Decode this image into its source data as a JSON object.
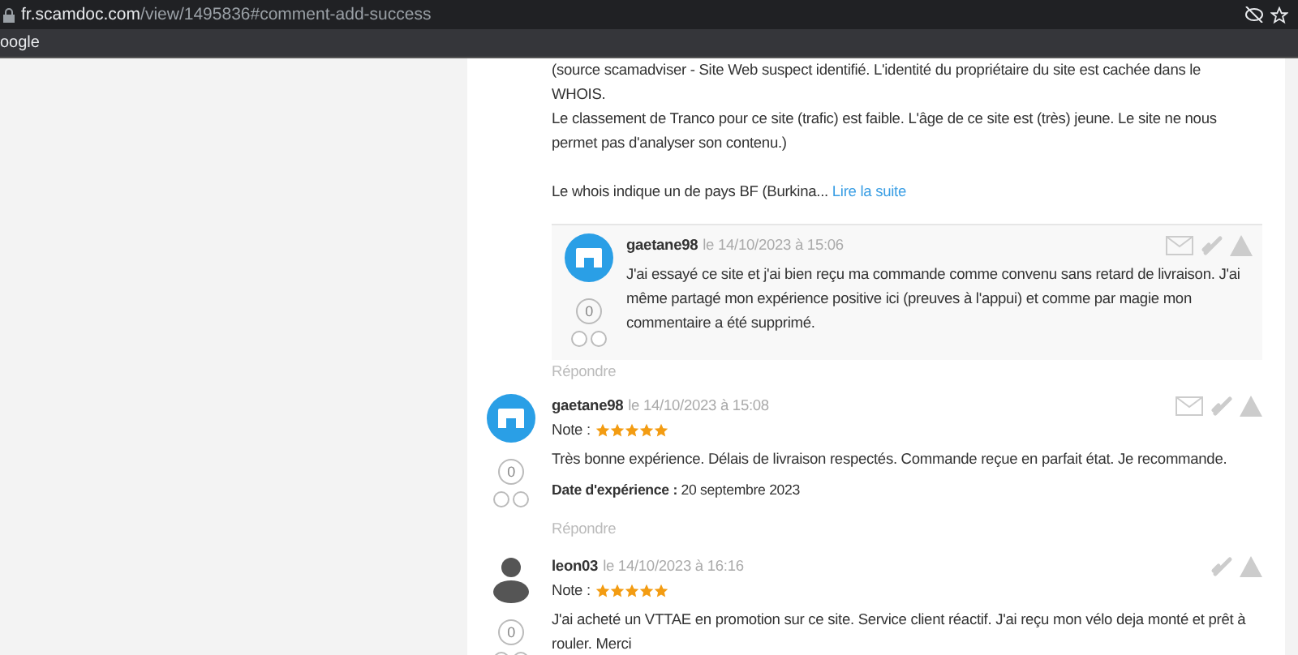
{
  "browser": {
    "host": "fr.scamdoc.com",
    "path": "/view/1495836#comment-add-success",
    "bookmark": "oogle"
  },
  "intro": {
    "lines": [
      "(source scamadviser - Site Web suspect identifié. L'identité du propriétaire du site est cachée dans le",
      "WHOIS.",
      "Le classement de Tranco pour ce site (trafic) est faible. L'âge de ce site est (très) jeune. Le site ne nous",
      "permet pas d'analyser son contenu.)"
    ],
    "excerpt": "Le whois indique un de pays BF (Burkina...",
    "link": "Lire la suite"
  },
  "reply": {
    "author": "gaetane98",
    "date": "le 14/10/2023 à 15:06",
    "kind": "logo",
    "score": "0",
    "text": "J'ai essayé ce site et j'ai bien reçu ma commande comme convenu sans retard de livraison. J'ai même partagé mon expérience positive ici (preuves à l'appui) et comme par magie mon commentaire a été supprimé.",
    "mail": true,
    "answer": "Répondre"
  },
  "comments": [
    {
      "author": "gaetane98",
      "date": "le 14/10/2023 à 15:08",
      "kind": "logo",
      "score": "0",
      "note_label": "Note :",
      "stars": 5,
      "text": "Très bonne expérience. Délais de livraison respectés. Commande reçue en parfait état. Je recommande.",
      "experience_label": "Date d'expérience :",
      "experience_date": "20 septembre 2023",
      "mail": true,
      "answer": "Répondre"
    },
    {
      "author": "leon03",
      "date": "le 14/10/2023 à 16:16",
      "kind": "person",
      "score": "0",
      "note_label": "Note :",
      "stars": 5,
      "text": "J'ai acheté un VTTAE en promotion sur ce site. Service client réactif. J'ai reçu mon vélo deja monté et prêt à rouler. Merci",
      "mail": false
    }
  ]
}
